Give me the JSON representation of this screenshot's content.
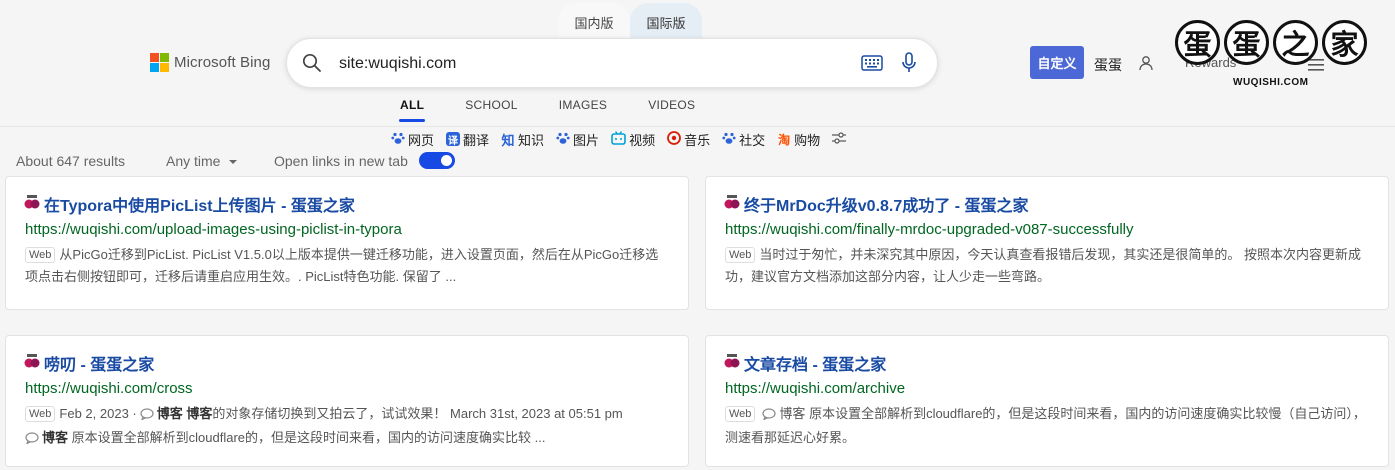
{
  "region_tabs": {
    "cn": "国内版",
    "intl": "国际版"
  },
  "logo": {
    "text": "Microsoft Bing",
    "colors": [
      "#f25022",
      "#7fba00",
      "#00a4ef",
      "#ffb900"
    ]
  },
  "search": {
    "value": "site:wuqishi.com",
    "placeholder": ""
  },
  "header": {
    "customize_label": "自定义",
    "user_name": "蛋蛋",
    "rewards_label": "Rewards"
  },
  "brand": {
    "chars": [
      "蛋",
      "蛋",
      "之",
      "家"
    ],
    "sub": "WUQISHI.COM"
  },
  "scope_tabs": [
    {
      "label": "ALL",
      "active": true
    },
    {
      "label": "SCHOOL",
      "active": false
    },
    {
      "label": "IMAGES",
      "active": false
    },
    {
      "label": "VIDEOS",
      "active": false
    }
  ],
  "quick_links": [
    {
      "label": "网页",
      "icon": "paw-icon",
      "color": "#2d63d8"
    },
    {
      "label": "翻译",
      "icon": "translate-icon",
      "color": "#2d63d8"
    },
    {
      "label": "知识",
      "icon": "knowledge-icon",
      "color": "#2d63d8"
    },
    {
      "label": "图片",
      "icon": "paw-icon",
      "color": "#2d63d8"
    },
    {
      "label": "视频",
      "icon": "tv-icon",
      "color": "#00a1d6"
    },
    {
      "label": "音乐",
      "icon": "music-icon",
      "color": "#d81e06"
    },
    {
      "label": "社交",
      "icon": "paw-icon",
      "color": "#2d63d8"
    },
    {
      "label": "购物",
      "icon": "shop-icon",
      "color": "#ff5000"
    }
  ],
  "results_info": {
    "count": "About 647 results",
    "time_filter": "Any time",
    "open_links_label": "Open links in new tab",
    "open_links_on": true
  },
  "results": [
    {
      "title": "在Typora中使用PicList上传图片 - 蛋蛋之家",
      "url": "https://wuqishi.com/upload-images-using-piclist-in-typora",
      "tag": "Web",
      "snippet": "从PicGo迁移到PicList. PicList V1.5.0以上版本提供一键迁移功能，进入设置页面，然后在从PicGo迁移选项点击右侧按钮即可，迁移后请重启应用生效。. PicList特色功能. 保留了 ..."
    },
    {
      "title": "终于MrDoc升级v0.8.7成功了 - 蛋蛋之家",
      "url": "https://wuqishi.com/finally-mrdoc-upgraded-v087-successfully",
      "tag": "Web",
      "snippet": "当时过于匆忙，并未深究其中原因，今天认真查看报错后发现，其实还是很简单的。 按照本次内容更新成功，建议官方文档添加这部分内容，让人少走一些弯路。"
    },
    {
      "title": "唠叨 - 蛋蛋之家",
      "url": "https://wuqishi.com/cross",
      "tag": "Web",
      "date": "Feb 2, 2023 ·",
      "line1_bold": "博客",
      "line1_author": "博客",
      "line1_rest": "的对象存储切换到又拍云了，试试效果！ March 31st, 2023 at 05:51 pm",
      "line2_bold": "博客",
      "line2_rest": "原本设置全部解析到cloudflare的，但是这段时间来看，国内的访问速度确实比较 ..."
    },
    {
      "title": "文章存档 - 蛋蛋之家",
      "url": "https://wuqishi.com/archive",
      "tag": "Web",
      "line1_bold": "博客",
      "line1_rest": "原本设置全部解析到cloudflare的，但是这段时间来看，国内的访问速度确实比较慢（自己访问），测速看那延迟心好累。"
    }
  ]
}
